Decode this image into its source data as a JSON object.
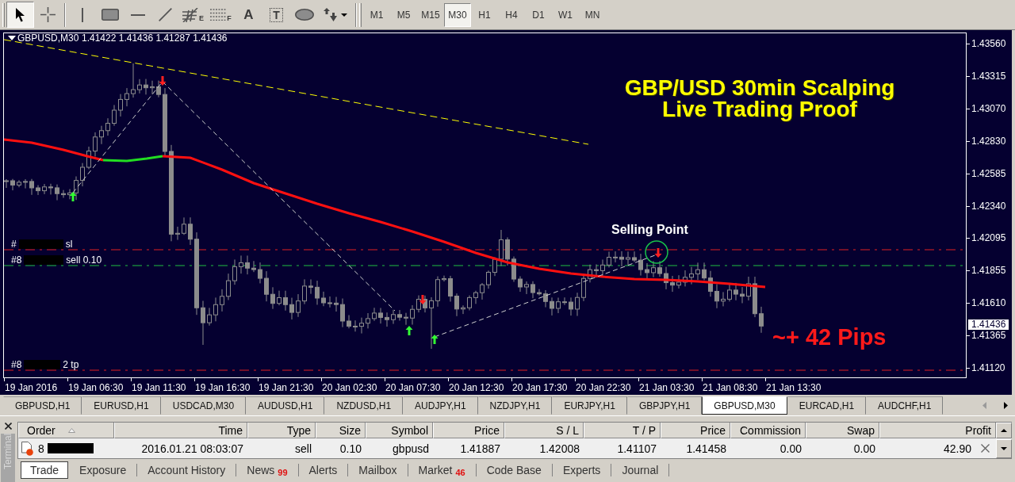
{
  "toolbar": {
    "tool_groups": [
      {
        "tools": [
          {
            "kind": "cursor",
            "selected": true
          },
          {
            "kind": "crosshair",
            "selected": false
          }
        ]
      },
      {
        "tools": [
          {
            "kind": "vertical-line",
            "selected": false
          },
          {
            "kind": "rectangle",
            "selected": false
          },
          {
            "kind": "horizontal-line",
            "selected": false
          },
          {
            "kind": "trend-line",
            "selected": false
          },
          {
            "kind": "fibo-lines",
            "label": "E",
            "selected": false
          },
          {
            "kind": "fibo-grid",
            "label": "F",
            "selected": false
          },
          {
            "kind": "text",
            "label": "A",
            "selected": false
          },
          {
            "kind": "text-label",
            "label": "T",
            "selected": false
          },
          {
            "kind": "ellipse",
            "selected": false
          },
          {
            "kind": "arrows-menu",
            "selected": false
          }
        ]
      }
    ],
    "timeframes": [
      {
        "label": "M1",
        "selected": false
      },
      {
        "label": "M5",
        "selected": false
      },
      {
        "label": "M15",
        "selected": false
      },
      {
        "label": "M30",
        "selected": true
      },
      {
        "label": "H1",
        "selected": false
      },
      {
        "label": "H4",
        "selected": false
      },
      {
        "label": "D1",
        "selected": false
      },
      {
        "label": "W1",
        "selected": false
      },
      {
        "label": "MN",
        "selected": false
      }
    ]
  },
  "chart": {
    "symbol": "GBPUSD,M30",
    "quote": "1.41422 1.41436 1.41287 1.41436",
    "title_lines": [
      "GBP/USD 30min Scalping",
      "Live Trading Proof"
    ],
    "callout": "Selling Point",
    "result": "~+ 42 Pips",
    "order_lines": [
      {
        "kind": "sl",
        "prefix": "#",
        "redacted": true,
        "suffix": "sl"
      },
      {
        "kind": "entry",
        "prefix": "#8",
        "redacted": true,
        "suffix": "sell 0.10"
      },
      {
        "kind": "tp",
        "prefix": "#8",
        "redacted": true,
        "suffix": "2 tp"
      }
    ],
    "price_axis": {
      "labels": [
        "1.43560",
        "1.43315",
        "1.43070",
        "1.42830",
        "1.42585",
        "1.42340",
        "1.42095",
        "1.41855",
        "1.41610",
        "1.41365",
        "1.41120"
      ],
      "current_price": "1.41436"
    },
    "time_axis": {
      "labels": [
        "19 Jan 2016",
        "19 Jan 06:30",
        "19 Jan 11:30",
        "19 Jan 16:30",
        "19 Jan 21:30",
        "20 Jan 02:30",
        "20 Jan 07:30",
        "20 Jan 12:30",
        "20 Jan 17:30",
        "20 Jan 22:30",
        "21 Jan 03:30",
        "21 Jan 08:30",
        "21 Jan 13:30"
      ]
    }
  },
  "chart_tabs": {
    "tabs": [
      {
        "label": "GBPUSD,H1",
        "selected": false
      },
      {
        "label": "EURUSD,H1",
        "selected": false
      },
      {
        "label": "USDCAD,M30",
        "selected": false
      },
      {
        "label": "AUDUSD,H1",
        "selected": false
      },
      {
        "label": "NZDUSD,H1",
        "selected": false
      },
      {
        "label": "AUDJPY,H1",
        "selected": false
      },
      {
        "label": "NZDJPY,H1",
        "selected": false
      },
      {
        "label": "EURJPY,H1",
        "selected": false
      },
      {
        "label": "GBPJPY,H1",
        "selected": false
      },
      {
        "label": "GBPUSD,M30",
        "selected": true
      },
      {
        "label": "EURCAD,H1",
        "selected": false
      },
      {
        "label": "AUDCHF,H1",
        "selected": false
      }
    ],
    "scroll_left_enabled": false,
    "scroll_right_enabled": true
  },
  "terminal": {
    "title": "Terminal",
    "columns": [
      {
        "label": "Order",
        "sorted": true
      },
      {
        "label": "Time",
        "sorted": false
      },
      {
        "label": "Type",
        "sorted": false
      },
      {
        "label": "Size",
        "sorted": false
      },
      {
        "label": "Symbol",
        "sorted": false
      },
      {
        "label": "Price",
        "sorted": false
      },
      {
        "label": "S / L",
        "sorted": false
      },
      {
        "label": "T / P",
        "sorted": false
      },
      {
        "label": "Price",
        "sorted": false
      },
      {
        "label": "Commission",
        "sorted": false
      },
      {
        "label": "Swap",
        "sorted": false
      },
      {
        "label": "Profit",
        "sorted": false
      }
    ],
    "rows": [
      {
        "redacted": true,
        "cells": [
          "8",
          "2016.01.21 08:03:07",
          "sell",
          "0.10",
          "gbpusd",
          "1.41887",
          "1.42008",
          "1.41107",
          "1.41458",
          "0.00",
          "0.00",
          "42.90"
        ]
      }
    ],
    "tabs": [
      {
        "label": "Trade",
        "selected": true
      },
      {
        "label": "Exposure",
        "selected": false
      },
      {
        "label": "Account History",
        "selected": false
      },
      {
        "label": "News",
        "badge": "99",
        "selected": false
      },
      {
        "label": "Alerts",
        "selected": false
      },
      {
        "label": "Mailbox",
        "selected": false
      },
      {
        "label": "Market",
        "badge": "46",
        "selected": false
      },
      {
        "label": "Code Base",
        "selected": false
      },
      {
        "label": "Experts",
        "selected": false
      },
      {
        "label": "Journal",
        "selected": false
      }
    ]
  }
}
